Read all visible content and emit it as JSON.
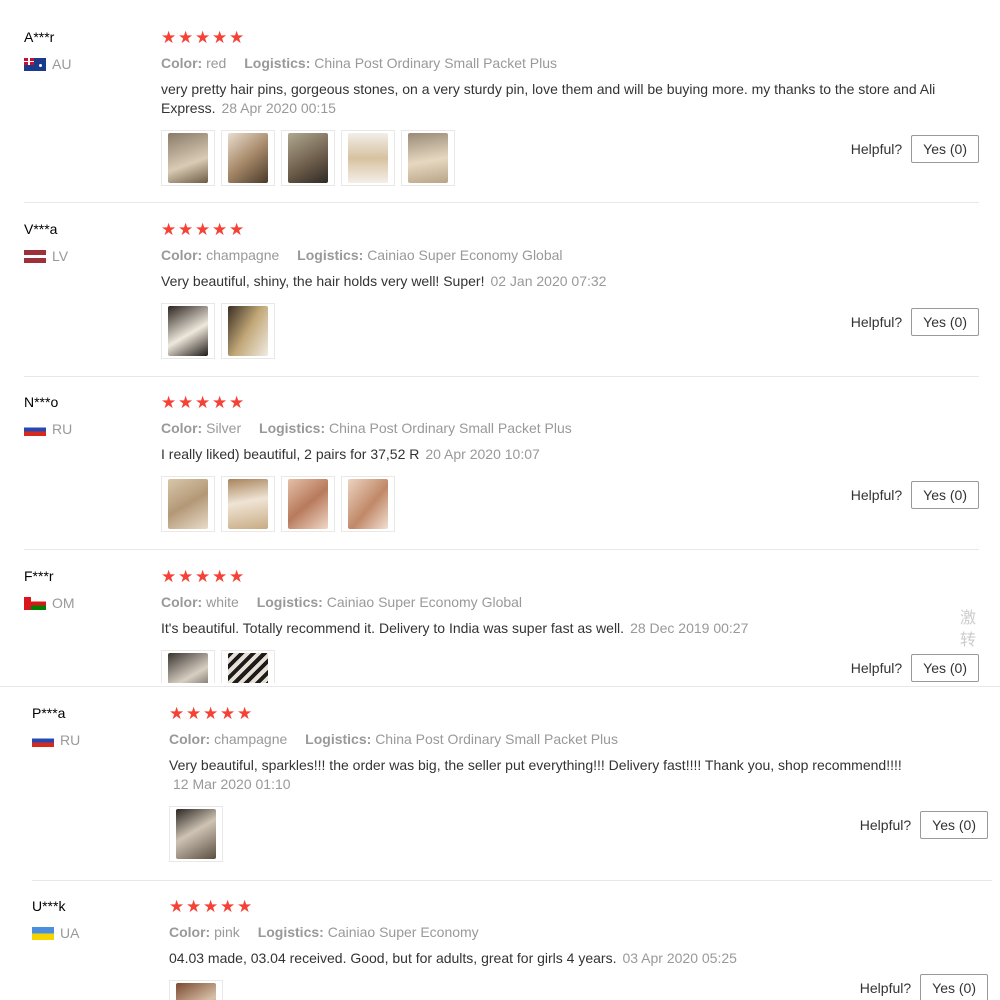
{
  "helpful_label": "Helpful?",
  "reviews": [
    {
      "user": "A***r",
      "country": "AU",
      "color_key": "Color:",
      "color": "red",
      "logistics_key": "Logistics:",
      "logistics": "China Post Ordinary Small Packet Plus",
      "text": "very pretty hair pins, gorgeous stones, on a very sturdy pin, love them and will be buying more. my thanks to the store and Ali Express.",
      "date": "28 Apr 2020 00:15",
      "yes": "Yes (0)"
    },
    {
      "user": "V***a",
      "country": "LV",
      "color_key": "Color:",
      "color": "champagne",
      "logistics_key": "Logistics:",
      "logistics": "Cainiao Super Economy Global",
      "text": "Very beautiful, shiny, the hair holds very well! Super!",
      "date": "02 Jan 2020 07:32",
      "yes": "Yes (0)"
    },
    {
      "user": "N***o",
      "country": "RU",
      "color_key": "Color:",
      "color": "Silver",
      "logistics_key": "Logistics:",
      "logistics": "China Post Ordinary Small Packet Plus",
      "text": "I really liked) beautiful, 2 pairs for 37,52 R",
      "date": "20 Apr 2020 10:07",
      "yes": "Yes (0)"
    },
    {
      "user": "F***r",
      "country": "OM",
      "color_key": "Color:",
      "color": "white",
      "logistics_key": "Logistics:",
      "logistics": "Cainiao Super Economy Global",
      "text": "It's beautiful. Totally recommend it. Delivery to India was super fast as well.",
      "date": "28 Dec 2019 00:27",
      "yes": "Yes (0)"
    },
    {
      "user": "P***a",
      "country": "RU",
      "color_key": "Color:",
      "color": "champagne",
      "logistics_key": "Logistics:",
      "logistics": "China Post Ordinary Small Packet Plus",
      "text": "Very beautiful, sparkles!!! the order was big, the seller put everything!!! Delivery fast!!!! Thank you, shop recommend!!!!",
      "date": "12 Mar 2020 01:10",
      "yes": "Yes (0)"
    },
    {
      "user": "U***k",
      "country": "UA",
      "color_key": "Color:",
      "color": "pink",
      "logistics_key": "Logistics:",
      "logistics": "Cainiao Super Economy",
      "text": "04.03 made, 03.04 received. Good, but for adults, great for girls 4 years.",
      "date": "03 Apr 2020 05:25",
      "yes": "Yes (0)"
    }
  ],
  "side_text": "激 转",
  "star_glyph": "★"
}
